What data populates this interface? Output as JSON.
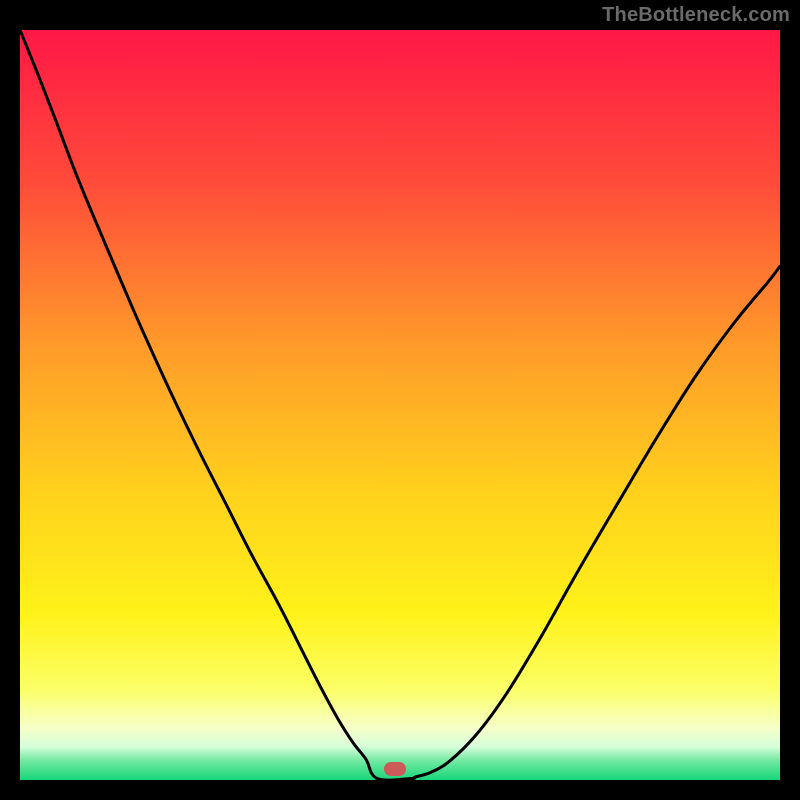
{
  "watermark": "TheBottleneck.com",
  "marker": {
    "x_frac": 0.493,
    "y_frac": 0.985
  },
  "chart_data": {
    "type": "line",
    "title": "",
    "xlabel": "",
    "ylabel": "",
    "xlim": [
      0,
      1
    ],
    "ylim": [
      0,
      1
    ],
    "background_gradient": [
      {
        "pos": 0.0,
        "color": "#ff1846"
      },
      {
        "pos": 0.2,
        "color": "#ff4a3a"
      },
      {
        "pos": 0.42,
        "color": "#ff9a2a"
      },
      {
        "pos": 0.62,
        "color": "#ffd21c"
      },
      {
        "pos": 0.78,
        "color": "#fff21a"
      },
      {
        "pos": 0.88,
        "color": "#fbff68"
      },
      {
        "pos": 0.93,
        "color": "#f6ffc8"
      },
      {
        "pos": 0.955,
        "color": "#d8ffda"
      },
      {
        "pos": 0.975,
        "color": "#6fe8a0"
      },
      {
        "pos": 1.0,
        "color": "#19d67a"
      }
    ],
    "series": [
      {
        "name": "bottleneck-curve",
        "x": [
          0.0,
          0.02,
          0.045,
          0.075,
          0.11,
          0.15,
          0.19,
          0.23,
          0.27,
          0.305,
          0.34,
          0.37,
          0.395,
          0.418,
          0.438,
          0.455,
          0.47,
          0.48,
          0.49,
          0.505,
          0.52,
          0.54,
          0.565,
          0.6,
          0.64,
          0.685,
          0.735,
          0.79,
          0.84,
          0.89,
          0.94,
          0.985,
          1.0
        ],
        "y": [
          1.0,
          0.95,
          0.885,
          0.805,
          0.72,
          0.625,
          0.535,
          0.45,
          0.37,
          0.3,
          0.235,
          0.175,
          0.125,
          0.082,
          0.05,
          0.028,
          0.012,
          0.005,
          0.002,
          0.002,
          0.004,
          0.01,
          0.025,
          0.06,
          0.115,
          0.19,
          0.28,
          0.375,
          0.46,
          0.54,
          0.61,
          0.665,
          0.685
        ]
      }
    ],
    "flat_segment": {
      "x_start": 0.47,
      "x_end": 0.515,
      "y": 0.002
    }
  }
}
